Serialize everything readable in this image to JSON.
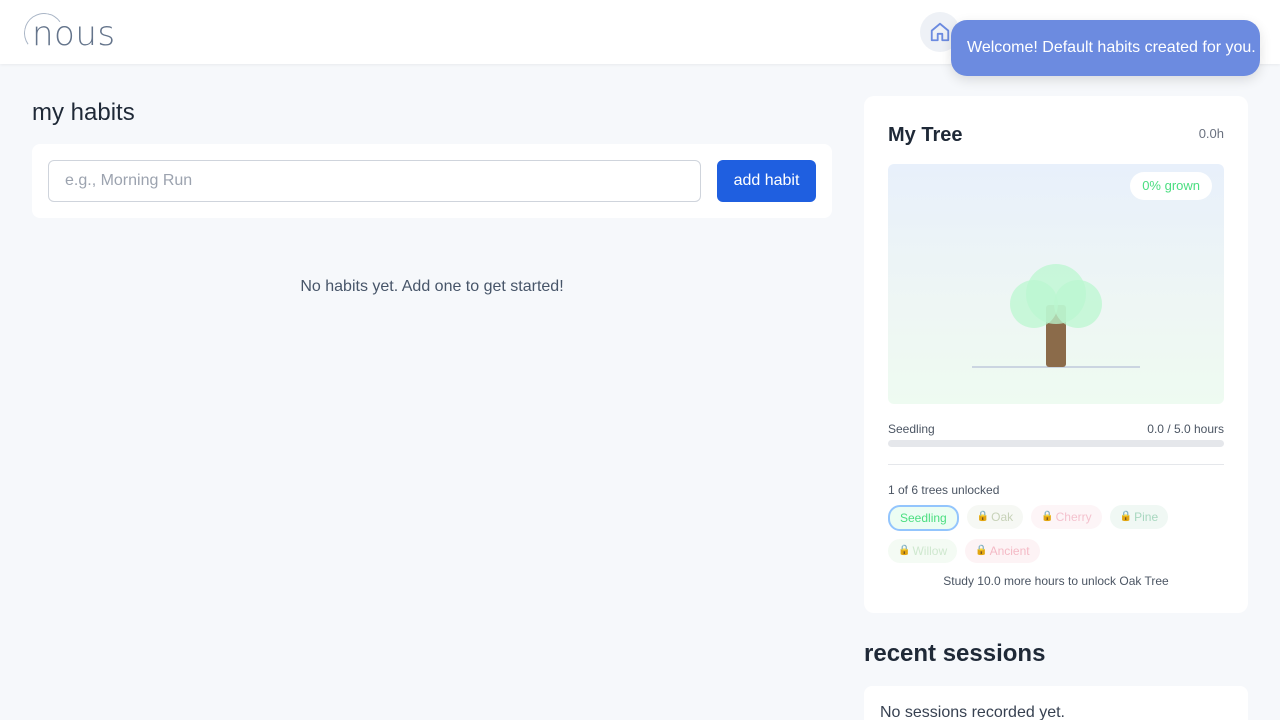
{
  "brand": {
    "name": "nous"
  },
  "nav": {
    "home_icon": "home-icon"
  },
  "toast": {
    "message": "Welcome! Default habits created for you."
  },
  "habits": {
    "title": "my habits",
    "input_placeholder": "e.g., Morning Run",
    "add_label": "add habit",
    "empty_message": "No habits yet. Add one to get started!"
  },
  "tree": {
    "title": "My Tree",
    "total_hours": "0.0h",
    "grown_label": "0% grown",
    "growth_percent": 0,
    "stage_label": "Seedling",
    "stage_hours": "0.0 / 5.0 hours",
    "unlock_count": "1 of 6 trees unlocked",
    "chips": [
      "Seedling",
      "Oak",
      "Cherry",
      "Pine",
      "Willow",
      "Ancient"
    ],
    "unlock_hint": "Study 10.0 more hours to unlock Oak Tree",
    "colors": {
      "canopy": "#bbf7d0",
      "trunk": "#8b6b4a",
      "accent_green": "#4ade80"
    }
  },
  "sessions": {
    "title": "recent sessions",
    "empty_message": "No sessions recorded yet."
  }
}
